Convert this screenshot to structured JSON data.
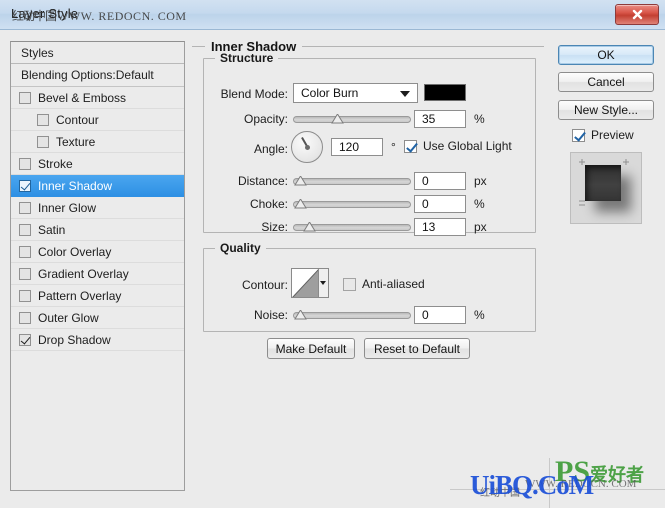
{
  "window": {
    "title": "Layer Style",
    "watermark_cn": "红动中国",
    "watermark_url": "WWW. REDOCN. COM",
    "close_label": "Close"
  },
  "styles_panel": {
    "header": "Styles",
    "blending_options": "Blending Options:Default",
    "items": [
      {
        "label": "Bevel & Emboss",
        "checked": false,
        "indent": false,
        "selected": false
      },
      {
        "label": "Contour",
        "checked": false,
        "indent": true,
        "selected": false
      },
      {
        "label": "Texture",
        "checked": false,
        "indent": true,
        "selected": false
      },
      {
        "label": "Stroke",
        "checked": false,
        "indent": false,
        "selected": false
      },
      {
        "label": "Inner Shadow",
        "checked": true,
        "indent": false,
        "selected": true
      },
      {
        "label": "Inner Glow",
        "checked": false,
        "indent": false,
        "selected": false
      },
      {
        "label": "Satin",
        "checked": false,
        "indent": false,
        "selected": false
      },
      {
        "label": "Color Overlay",
        "checked": false,
        "indent": false,
        "selected": false
      },
      {
        "label": "Gradient Overlay",
        "checked": false,
        "indent": false,
        "selected": false
      },
      {
        "label": "Pattern Overlay",
        "checked": false,
        "indent": false,
        "selected": false
      },
      {
        "label": "Outer Glow",
        "checked": false,
        "indent": false,
        "selected": false
      },
      {
        "label": "Drop Shadow",
        "checked": true,
        "indent": false,
        "selected": false
      }
    ]
  },
  "main": {
    "section_title": "Inner Shadow",
    "structure": {
      "legend": "Structure",
      "blend_mode_label": "Blend Mode:",
      "blend_mode_value": "Color Burn",
      "color_swatch": "#000000",
      "opacity_label": "Opacity:",
      "opacity_value": "35",
      "opacity_unit": "%",
      "opacity_percent": 35,
      "angle_label": "Angle:",
      "angle_value": "120",
      "angle_unit": "°",
      "use_global_light_label": "Use Global Light",
      "use_global_light_checked": true,
      "distance_label": "Distance:",
      "distance_value": "0",
      "distance_unit": "px",
      "distance_percent": 0,
      "choke_label": "Choke:",
      "choke_value": "0",
      "choke_unit": "%",
      "choke_percent": 0,
      "size_label": "Size:",
      "size_value": "13",
      "size_unit": "px",
      "size_percent": 9
    },
    "quality": {
      "legend": "Quality",
      "contour_label": "Contour:",
      "anti_aliased_label": "Anti-aliased",
      "anti_aliased_checked": false,
      "noise_label": "Noise:",
      "noise_value": "0",
      "noise_unit": "%",
      "noise_percent": 0
    },
    "make_default_label": "Make Default",
    "reset_default_label": "Reset to Default"
  },
  "actions": {
    "ok_label": "OK",
    "cancel_label": "Cancel",
    "new_style_label": "New Style...",
    "preview_label": "Preview",
    "preview_checked": true
  },
  "overlay_watermarks": {
    "bottom_site": "UiBQ.CoM",
    "ps_logo": "PS",
    "ps_cn": "爱好者",
    "small_cn": "红动中国",
    "mid_text": "WWW. REDOCN. COM"
  },
  "colors": {
    "accent_selection": "#2e90e4",
    "dialog_bg": "#ebebeb",
    "titlebar": "#c5d9ee",
    "close_red": "#c33f32"
  }
}
